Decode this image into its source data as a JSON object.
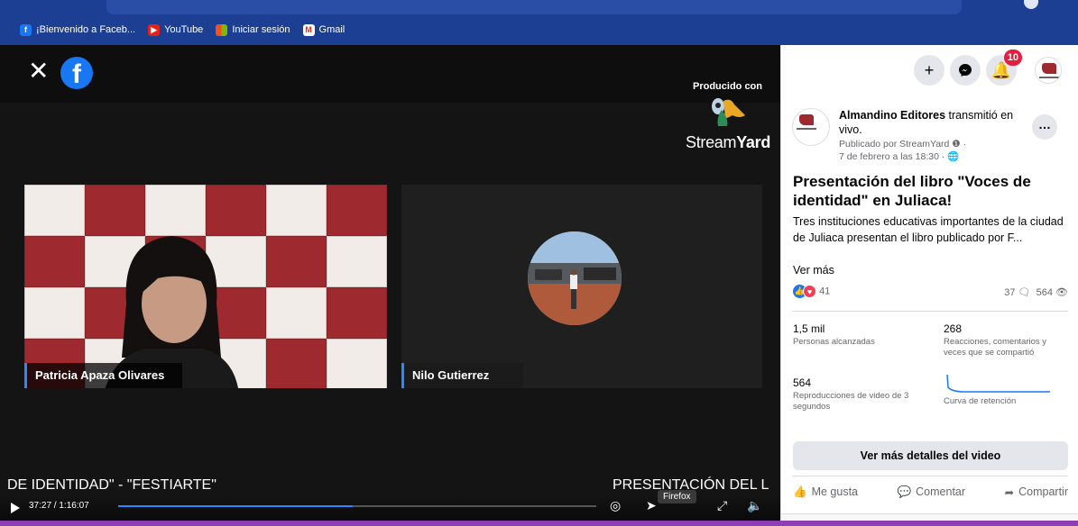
{
  "browser": {
    "bookmarks": [
      {
        "label": "¡Bienvenido a Faceb...",
        "icon": "facebook-icon"
      },
      {
        "label": "YouTube",
        "icon": "youtube-icon"
      },
      {
        "label": "Iniciar sesión",
        "icon": "microsoft-icon"
      },
      {
        "label": "Gmail",
        "icon": "gmail-icon"
      }
    ]
  },
  "video": {
    "produced_by": "Producido con",
    "streamyard_text": "Stream",
    "streamyard_bold": "Yard",
    "participants": [
      {
        "name": "Patricia Apaza Olivares"
      },
      {
        "name": "Nilo Gutierrez"
      }
    ],
    "ticker_left": "DE IDENTIDAD\" - \"FESTIARTE\"",
    "ticker_right": "PRESENTACIÓN DEL L",
    "time": "37:27 / 1:16:07",
    "progress_fraction": 0.49,
    "tooltip": "Firefox"
  },
  "panel": {
    "notifications_count": "10",
    "post": {
      "page_name": "Almandino Editores",
      "action": " transmitió en vivo.",
      "published_by": "Publicado por StreamYard",
      "date": "7 de febrero a las 18:30",
      "title": "Presentación del libro \"Voces de identidad\" en Juliaca!",
      "text": "Tres instituciones educativas importantes de la ciudad de Juliaca presentan el libro publicado por F...",
      "see_more": "Ver más",
      "reactions_count": "41",
      "comments_count": "37",
      "views_count": "564"
    },
    "stats": {
      "reach_value": "1,5 mil",
      "reach_label": "Personas alcanzadas",
      "engagement_value": "268",
      "engagement_label": "Reacciones, comentarios y veces que se compartió",
      "plays_value": "564",
      "plays_label": "Reproducciones de video de 3 segundos",
      "retention_label": "Curva de retención"
    },
    "more_details": "Ver más detalles del video",
    "actions": {
      "like": "Me gusta",
      "comment": "Comentar",
      "share": "Compartir"
    }
  },
  "colors": {
    "facebook_blue": "#1877f2",
    "brand_red": "#9e2a2f",
    "badge_red": "#e41e3f",
    "chrome_blue": "#1c3f94"
  }
}
